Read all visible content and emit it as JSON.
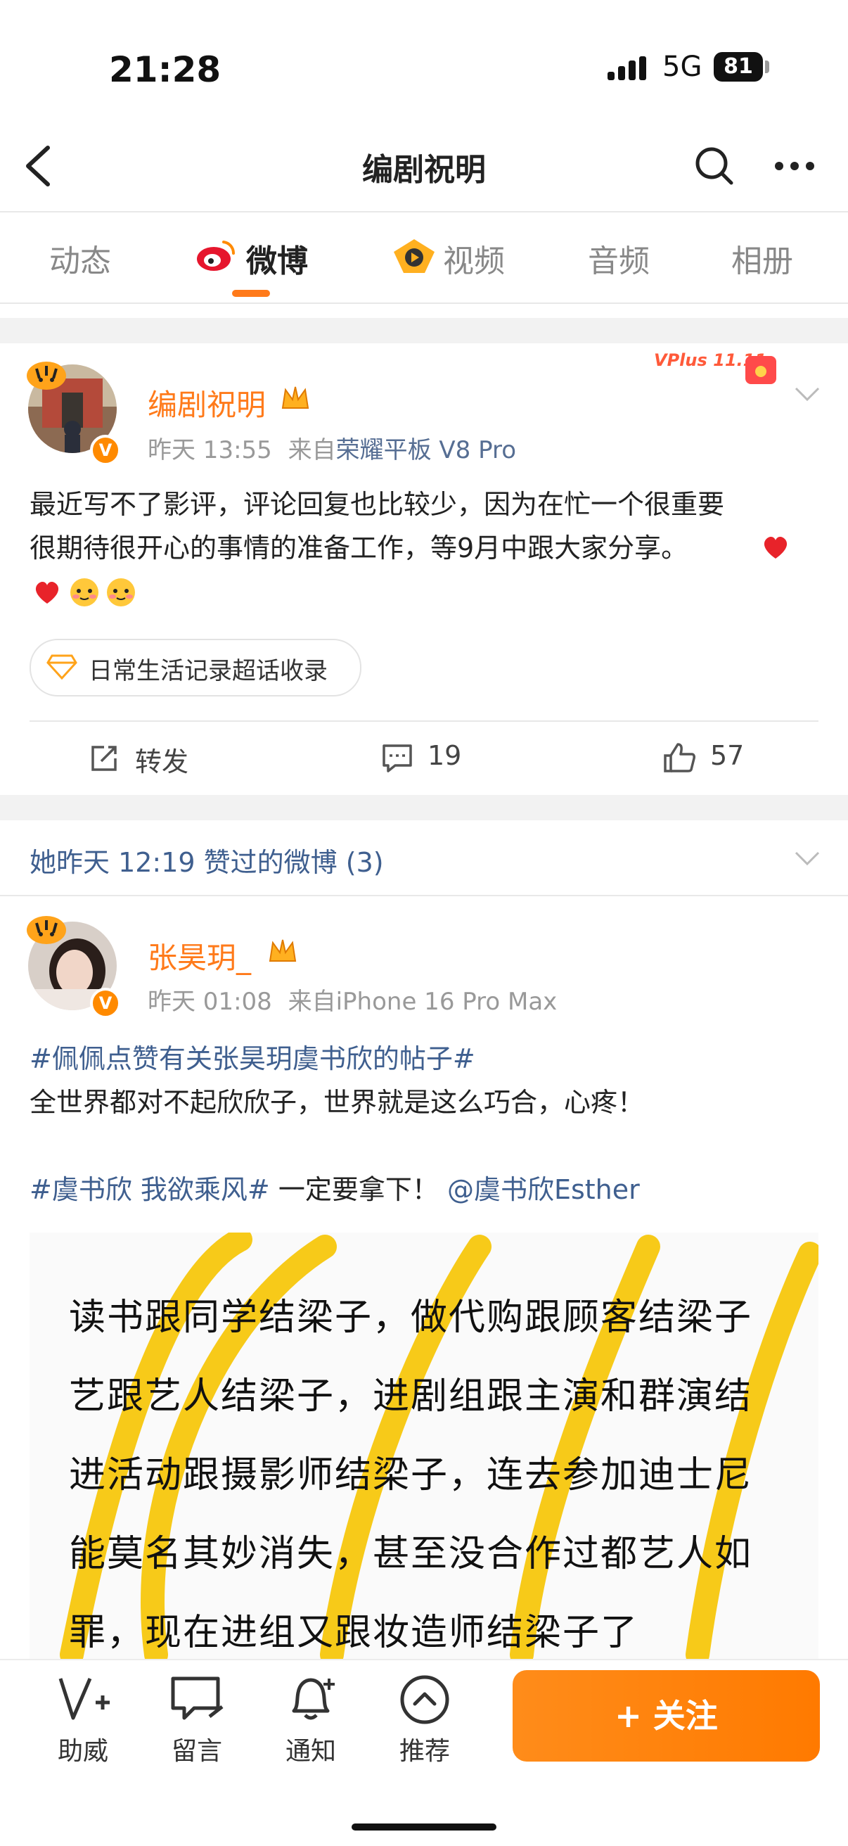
{
  "status": {
    "time": "21:28",
    "network": "5G",
    "battery": "81"
  },
  "nav": {
    "title": "编剧祝明",
    "back_icon": "chevron-left-icon",
    "search_icon": "search-icon",
    "more_icon": "more-icon"
  },
  "tabs": [
    {
      "label": "动态"
    },
    {
      "label": "微博"
    },
    {
      "label": "视频"
    },
    {
      "label": "音频"
    },
    {
      "label": "相册"
    }
  ],
  "post1": {
    "username": "编剧祝明",
    "time": "昨天 13:55",
    "source_prefix": "来自",
    "source": "荣耀平板 V8 Pro",
    "badge": "VPlus 11.11",
    "text_line1": "最近写不了影评，评论回复也比较少，因为在忙一个很重要",
    "text_line2": "很期待很开心的事情的准备工作，等9月中跟大家分享。",
    "tag": "日常生活记录超话收录",
    "repost_label": "转发",
    "comments": "19",
    "likes": "57"
  },
  "liked_header": "她昨天 12:19 赞过的微博 (3)",
  "post2": {
    "username": "张昊玥_",
    "time": "昨天 01:08",
    "source_prefix": "来自",
    "source": "iPhone 16 Pro Max",
    "topic1": "#佩佩点赞有关张昊玥虞书欣的帖子#",
    "text1": "全世界都对不起欣欣子，世界就是这么巧合，心疼！",
    "topic2": "#虞书欣 我欲乘风#",
    "text2": " 一定要拿下！",
    "mention": "@虞书欣Esther",
    "image_lines": [
      "读书跟同学结梁子，做代购跟顾客结梁子",
      "艺跟艺人结梁子，进剧组跟主演和群演结",
      "进活动跟摄影师结梁子，连去参加迪士尼",
      "能莫名其妙消失，甚至没合作过都艺人如",
      "罪，现在进组又跟妆造师结梁子了"
    ]
  },
  "bottom": {
    "items": [
      {
        "label": "助威",
        "icon": "v-plus-icon"
      },
      {
        "label": "留言",
        "icon": "message-icon"
      },
      {
        "label": "通知",
        "icon": "bell-plus-icon"
      },
      {
        "label": "推荐",
        "icon": "chevron-up-circle-icon"
      }
    ],
    "follow": "+ 关注"
  },
  "colors": {
    "accent": "#ff7a1a",
    "link": "#3f5f8f",
    "gray": "#999999"
  }
}
